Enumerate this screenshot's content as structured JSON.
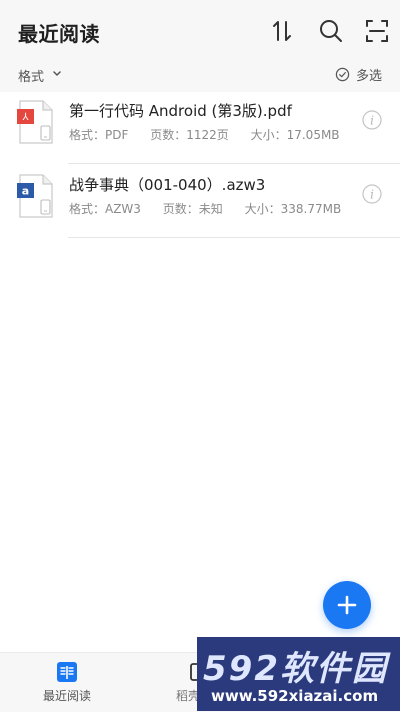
{
  "header": {
    "title": "最近阅读"
  },
  "filter": {
    "label": "格式",
    "multi_select_label": "多选"
  },
  "files": [
    {
      "name": "第一行代码 Android (第3版).pdf",
      "format": "格式：PDF",
      "pages": "页数：1122页",
      "size": "大小：17.05MB",
      "badge": "pdf",
      "badge_color": "#e5473e"
    },
    {
      "name": "战争事典（001-040）.azw3",
      "format": "格式：AZW3",
      "pages": "页数：未知",
      "size": "大小：338.77MB",
      "badge": "a",
      "badge_color": "#2a5aa8"
    }
  ],
  "tabs": [
    {
      "label": "最近阅读",
      "active": true
    },
    {
      "label": "稻壳阅读",
      "active": false
    }
  ],
  "watermark": {
    "brand": "592软件园",
    "url": "www.592xiazai.com"
  },
  "colors": {
    "accent": "#1a78f2",
    "background": "#ffffff",
    "bar": "#f7f7f7"
  }
}
